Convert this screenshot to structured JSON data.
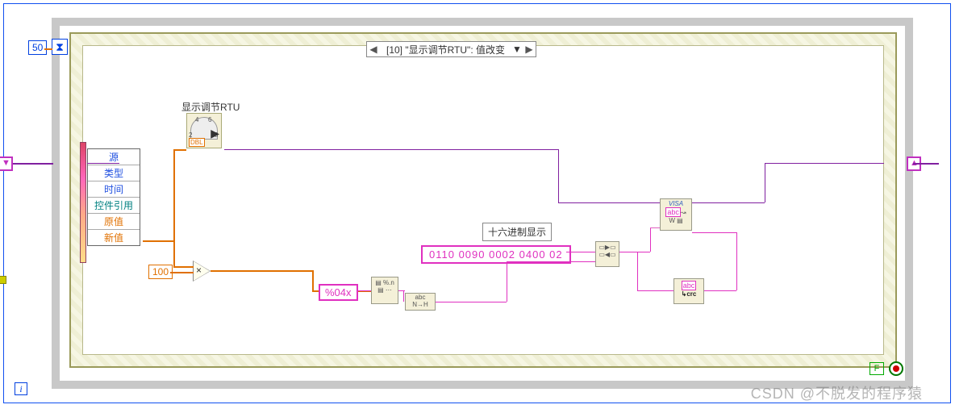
{
  "title_control": "显示调节RTU",
  "case_selector": "[10] \"显示调节RTU\": 值改变",
  "loop_delay_ms": "50",
  "iteration_symbol": "i",
  "stop_symbol": "F",
  "event_items": {
    "source": "源",
    "type": "类型",
    "time": "时间",
    "ctl_ref": "控件引用",
    "old_val": "原值",
    "new_val": "新值"
  },
  "multiply_constant": "100",
  "format_string": "%04x",
  "hex_label": "十六进制显示",
  "hex_constant": "0110 0090 0002 0400 02",
  "visa_label_top": "VISA",
  "visa_label_mid": "abc",
  "crc_label_top": "abc",
  "crc_label_bot": "↳crc",
  "dbl_tag": "DBL",
  "dial_marks": {
    "left": "2",
    "top": "4",
    "top2": "6",
    "right": "8"
  },
  "watermark": "CSDN @不脱发的程序猿"
}
